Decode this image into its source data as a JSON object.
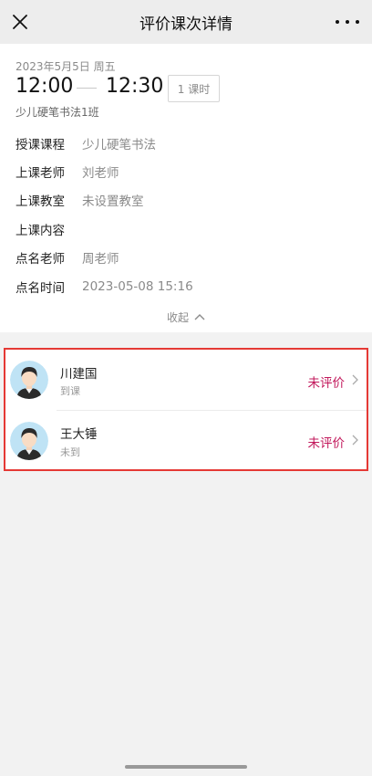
{
  "nav": {
    "title": "评价课次详情",
    "close_icon": "close-icon",
    "more_icon": "more-icon"
  },
  "session": {
    "date": "2023年5月5日 周五",
    "start_time": "12:00",
    "end_time": "12:30",
    "lesson_count": "1 课时",
    "class_name": "少儿硬笔书法1班"
  },
  "details": [
    {
      "label": "授课课程",
      "value": "少儿硬笔书法"
    },
    {
      "label": "上课老师",
      "value": "刘老师"
    },
    {
      "label": "上课教室",
      "value": "未设置教室"
    },
    {
      "label": "上课内容",
      "value": ""
    },
    {
      "label": "点名老师",
      "value": "周老师"
    },
    {
      "label": "点名时间",
      "value": "2023-05-08 15:16"
    }
  ],
  "collapse_label": "收起",
  "students": [
    {
      "name": "川建国",
      "attendance": "到课",
      "eval_status": "未评价"
    },
    {
      "name": "王大锤",
      "attendance": "未到",
      "eval_status": "未评价"
    }
  ],
  "colors": {
    "accent": "#c2185b",
    "highlight_border": "#e53935",
    "avatar_bg": "#bfe3f5"
  }
}
